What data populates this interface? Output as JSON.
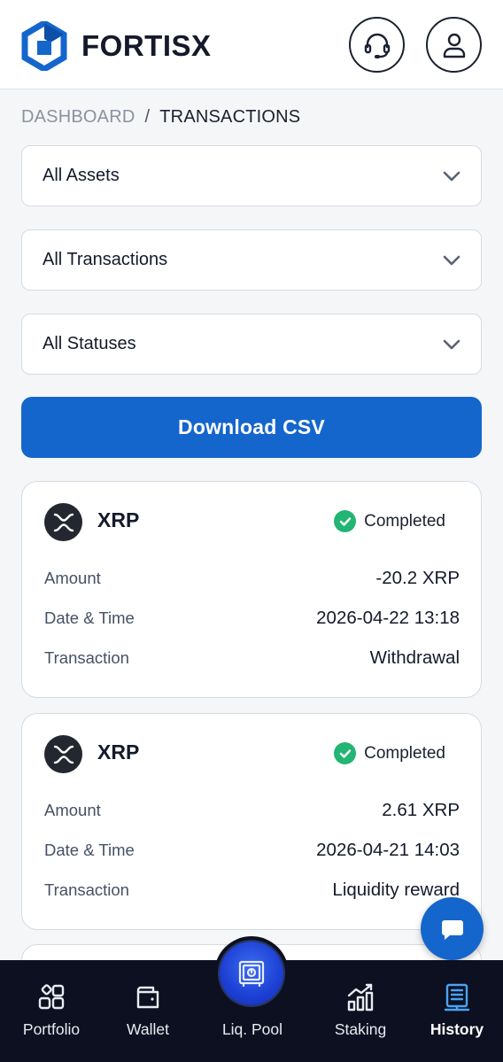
{
  "app": {
    "brand": "FORTISX"
  },
  "breadcrumb": {
    "root": "DASHBOARD",
    "separator": "/",
    "current": "TRANSACTIONS"
  },
  "filters": {
    "assets": "All Assets",
    "transactions": "All Transactions",
    "statuses": "All Statuses"
  },
  "actions": {
    "download_csv": "Download CSV"
  },
  "labels": {
    "amount": "Amount",
    "datetime": "Date & Time",
    "transaction": "Transaction"
  },
  "transactions": [
    {
      "asset": "XRP",
      "status": "Completed",
      "amount": "-20.2 XRP",
      "datetime": "2026-04-22 13:18",
      "type": "Withdrawal"
    },
    {
      "asset": "XRP",
      "status": "Completed",
      "amount": "2.61 XRP",
      "datetime": "2026-04-21 14:03",
      "type": "Liquidity reward"
    }
  ],
  "nav": {
    "portfolio": "Portfolio",
    "wallet": "Wallet",
    "liq_pool": "Liq. Pool",
    "staking": "Staking",
    "history": "History",
    "active": "history"
  },
  "colors": {
    "primary": "#1466cc",
    "nav_bg": "#0d1020",
    "success": "#22b573",
    "active_icon": "#4aa3f5"
  },
  "icons": {
    "header": [
      "headset-icon",
      "user-icon"
    ],
    "nav": [
      "portfolio-grid-icon",
      "wallet-icon",
      "vault-icon",
      "chart-bars-icon",
      "history-list-icon"
    ]
  }
}
